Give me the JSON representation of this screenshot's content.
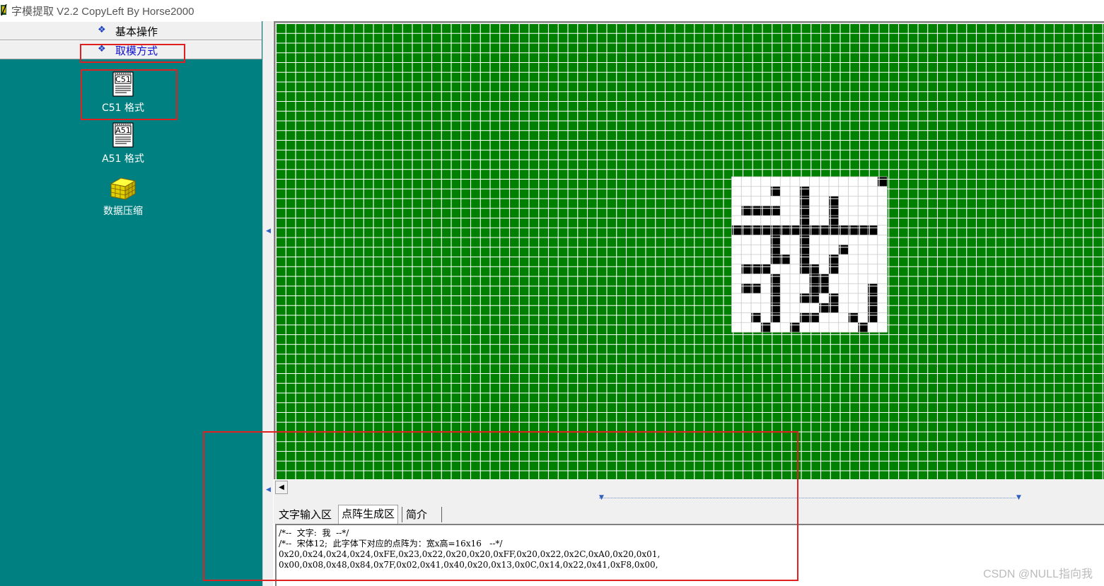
{
  "window": {
    "title": "字模提取 V2.2  CopyLeft By Horse2000"
  },
  "sidebar": {
    "sections": [
      {
        "label": "基本操作",
        "icon": "diamond-bullet-icon"
      },
      {
        "label": "取模方式",
        "icon": "diamond-bullet-icon"
      }
    ],
    "items": [
      {
        "label": "C51 格式",
        "icon": "c51-document-icon",
        "icon_text": "C51"
      },
      {
        "label": "A51 格式",
        "icon": "a51-document-icon",
        "icon_text": "A51"
      },
      {
        "label": "数据压缩",
        "icon": "yellow-cube-icon"
      }
    ]
  },
  "canvas": {
    "grid_color": "#008000",
    "line_color": "#ffffff",
    "glyph": "我",
    "glyph_size": "16x16",
    "bitmap": [
      "0000000000000001",
      "0000100100000000",
      "0000000100100000",
      "0111100100100000",
      "0000000100100000",
      "1111111111111110",
      "0000100100000000",
      "0000100100010000",
      "0000110100100000",
      "0111000110100000",
      "0000100011000000",
      "0110100011000010",
      "0000100110100010",
      "0000100001100010",
      "0010100110001010",
      "0001001000000100"
    ]
  },
  "tabs": [
    {
      "label": "文字输入区",
      "active": false
    },
    {
      "label": "点阵生成区",
      "active": true
    },
    {
      "label": "简介",
      "active": false
    }
  ],
  "output": {
    "lines": [
      "/*--  文字:  我  --*/",
      "/*--  宋体12;  此字体下对应的点阵为：宽x高=16x16   --*/",
      "0x20,0x24,0x24,0x24,0xFE,0x23,0x22,0x20,0x20,0xFF,0x20,0x22,0x2C,0xA0,0x20,0x01,",
      "0x00,0x08,0x48,0x84,0x7F,0x02,0x41,0x40,0x20,0x13,0x0C,0x14,0x22,0x41,0xF8,0x00,"
    ]
  },
  "colors": {
    "sidebar_bg": "#008080",
    "highlight": "#e02020",
    "pixel_on": "#000000",
    "pixel_off": "#ffffff"
  },
  "watermark": "CSDN @NULL指向我"
}
